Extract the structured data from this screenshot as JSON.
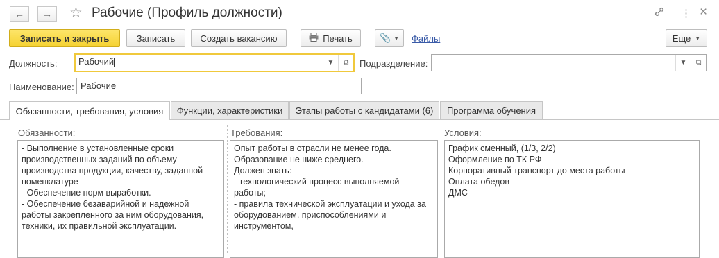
{
  "window": {
    "title": "Рабочие (Профиль должности)",
    "back_icon": "←",
    "forward_icon": "→",
    "link_icon": "🔗",
    "menu_icon": "⋮",
    "close_icon": "×"
  },
  "toolbar": {
    "save_close": "Записать и закрыть",
    "save": "Записать",
    "create_vacancy": "Создать вакансию",
    "print": "Печать",
    "files_link": "Файлы",
    "more": "Еще"
  },
  "form": {
    "position_label": "Должность:",
    "position_value": "Рабочий",
    "department_label": "Подразделение:",
    "department_value": "",
    "name_label": "Наименование:",
    "name_value": "Рабочие"
  },
  "tabs": [
    {
      "label": "Обязанности, требования, условия"
    },
    {
      "label": "Функции, характеристики"
    },
    {
      "label": "Этапы работы с кандидатами (6)"
    },
    {
      "label": "Программа обучения"
    }
  ],
  "columns": {
    "duties_label": "Обязанности:",
    "duties_text": "- Выполнение в установленные сроки\nпроизводственных заданий по объему\nпроизводства продукции, качеству, заданной\nноменклатуре\n- Обеспечение норм выработки.\n- Обеспечение безаварийной и надежной\nработы закрепленного за ним оборудования,\nтехники, их правильной эксплуатации.",
    "requirements_label": "Требования:",
    "requirements_text": "Опыт работы в отрасли не менее года.\nОбразование не ниже среднего.\nДолжен знать:\n- технологический процесс выполняемой\nработы;\n- правила технической эксплуатации и ухода за\nоборудованием, приспособлениями и\nинструментом,",
    "conditions_label": "Условия:",
    "conditions_text": "График сменный, (1/3, 2/2)\nОформление по ТК РФ\nКорпоративный транспорт до места работы\nОплата обедов\nДМС"
  }
}
